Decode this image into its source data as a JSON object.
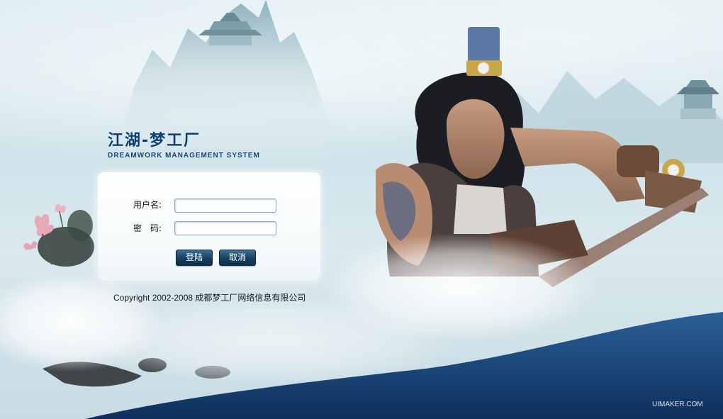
{
  "logo": {
    "title_cn": "江湖-梦工厂",
    "title_en": "DREAMWORK MANAGEMENT SYSTEM"
  },
  "login": {
    "username_label": "用户名:",
    "username_value": "",
    "password_label": "密　码:",
    "password_value": "",
    "login_button": "登陆",
    "cancel_button": "取消"
  },
  "footer": {
    "copyright": "Copyright 2002-2008 成都梦工厂网络信息有限公司"
  },
  "watermark": "UIMAKER.COM",
  "colors": {
    "logo_blue": "#0e3f73",
    "button_dark": "#173f5f",
    "sky": "#dfeef3",
    "sea": "#1c4f8a"
  }
}
